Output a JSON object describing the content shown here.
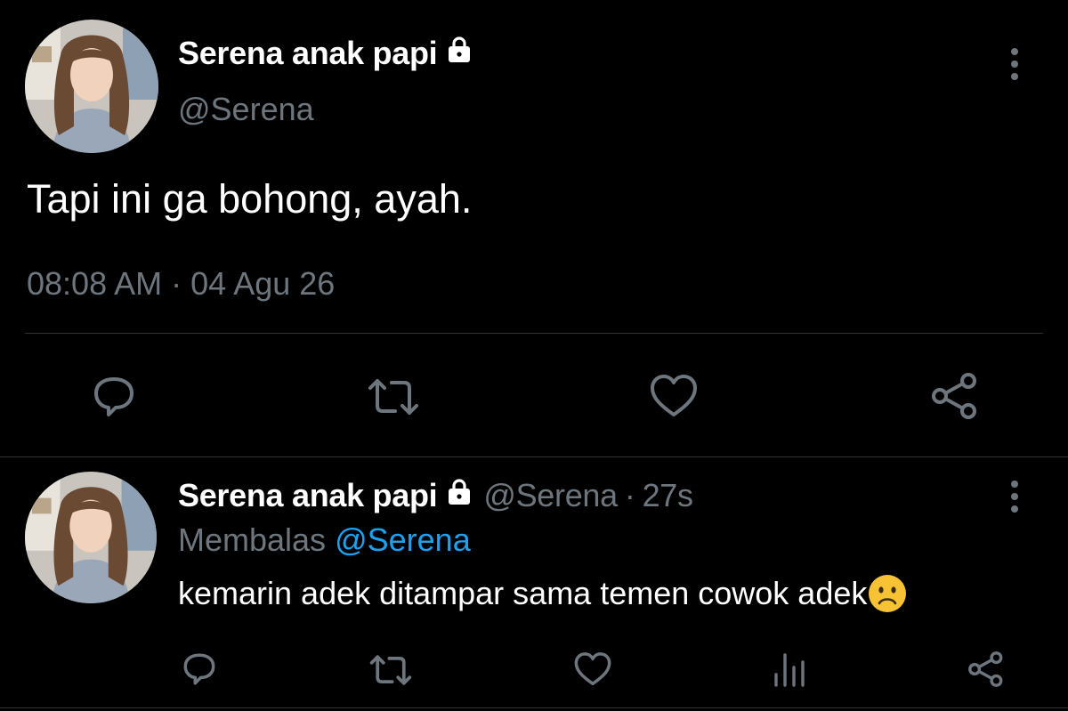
{
  "colors": {
    "background": "#000000",
    "text": "#ffffff",
    "secondary": "#6e767d",
    "accent": "#1da1f2",
    "divider": "#2f3336"
  },
  "main_tweet": {
    "display_name": "Serena anak papi",
    "handle": "@Serena",
    "text": "Tapi ini ga bohong, ayah.",
    "time": "08:08 AM",
    "separator": "·",
    "date": "04 Agu 26",
    "actions": [
      "reply-icon",
      "retweet-icon",
      "like-icon",
      "share-icon"
    ]
  },
  "reply_tweet": {
    "display_name": "Serena anak papi",
    "handle": "@Serena",
    "separator": "·",
    "age": "27s",
    "replying_prefix": "Membalas",
    "replying_to": "@Serena",
    "text": "kemarin adek ditampar sama temen cowok adek",
    "emoji": "frowning-face-emoji",
    "actions": [
      "reply-icon",
      "retweet-icon",
      "like-icon",
      "analytics-icon",
      "share-icon"
    ]
  }
}
